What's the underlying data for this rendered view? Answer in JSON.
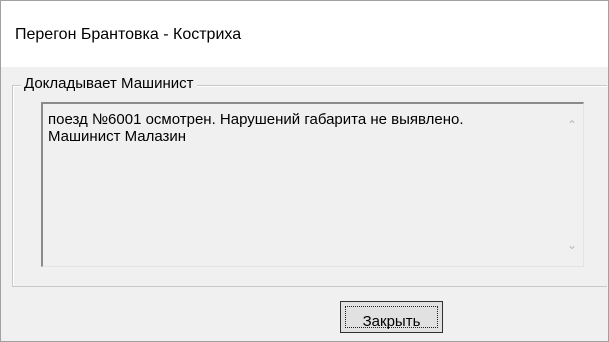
{
  "window": {
    "title": "Перегон Брантовка - Костриха"
  },
  "report": {
    "group_label": "Докладывает Машинист",
    "message_lines": [
      "поезд №6001 осмотрен. Нарушений габарита не выявлено.",
      "Машинист Малазин"
    ],
    "scroll_up_icon": "chevron-up-icon",
    "scroll_down_icon": "chevron-down-icon"
  },
  "actions": {
    "close_label": "Закрыть"
  }
}
